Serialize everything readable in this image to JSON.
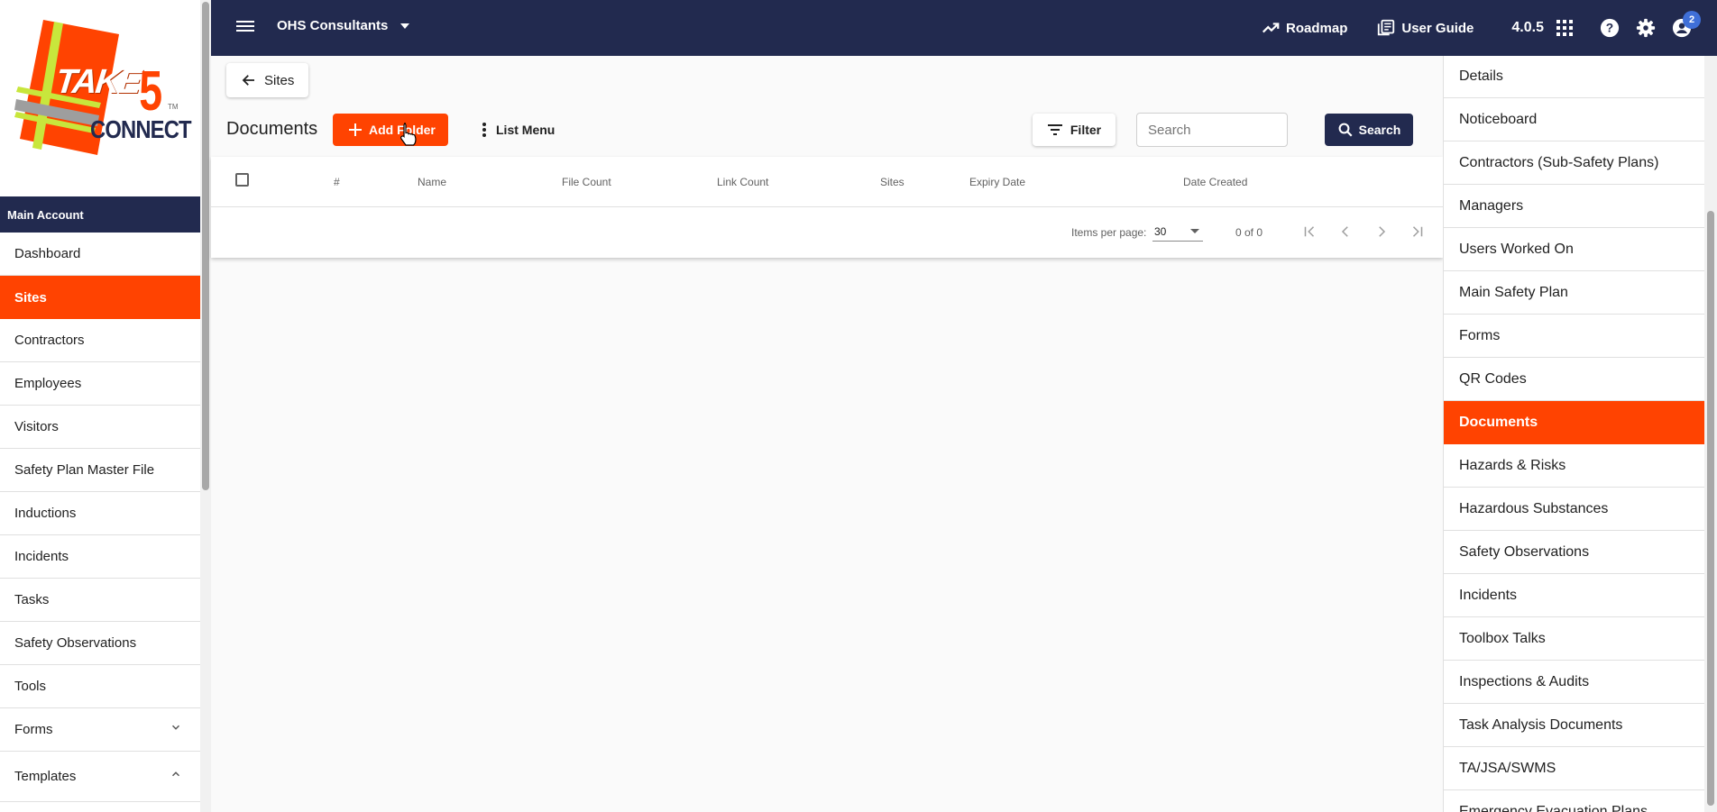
{
  "brand": {
    "logo_top": "TAKE",
    "logo_five": "5",
    "logo_bottom": "CONNECT",
    "logo_tm": "TM"
  },
  "sidebar": {
    "account_header": "Main Account",
    "items": [
      {
        "label": "Dashboard",
        "active": false
      },
      {
        "label": "Sites",
        "active": true
      },
      {
        "label": "Contractors",
        "active": false
      },
      {
        "label": "Employees",
        "active": false
      },
      {
        "label": "Visitors",
        "active": false
      },
      {
        "label": "Safety Plan Master File",
        "active": false
      },
      {
        "label": "Inductions",
        "active": false
      },
      {
        "label": "Incidents",
        "active": false
      },
      {
        "label": "Tasks",
        "active": false
      },
      {
        "label": "Safety Observations",
        "active": false
      },
      {
        "label": "Tools",
        "active": false
      },
      {
        "label": "Forms",
        "active": false
      },
      {
        "label": "Templates",
        "active": false
      }
    ]
  },
  "topbar": {
    "org_name": "OHS Consultants",
    "roadmap": "Roadmap",
    "user_guide": "User Guide",
    "version": "4.0.5",
    "notification_count": "2"
  },
  "main": {
    "back_label": "Sites",
    "title": "Documents",
    "add_folder": "Add Folder",
    "list_menu": "List Menu",
    "filter": "Filter",
    "search_placeholder": "Search",
    "search_button": "Search",
    "columns": [
      "#",
      "Name",
      "File Count",
      "Link Count",
      "Sites",
      "Expiry Date",
      "Date Created"
    ],
    "paginator": {
      "items_per_page_label": "Items per page:",
      "page_size": "30",
      "range": "0 of 0"
    }
  },
  "right_panel": {
    "items": [
      {
        "label": "Details",
        "active": false
      },
      {
        "label": "Noticeboard",
        "active": false
      },
      {
        "label": "Contractors (Sub-Safety Plans)",
        "active": false
      },
      {
        "label": "Managers",
        "active": false
      },
      {
        "label": "Users Worked On",
        "active": false
      },
      {
        "label": "Main Safety Plan",
        "active": false
      },
      {
        "label": "Forms",
        "active": false
      },
      {
        "label": "QR Codes",
        "active": false
      },
      {
        "label": "Documents",
        "active": true
      },
      {
        "label": "Hazards & Risks",
        "active": false
      },
      {
        "label": "Hazardous Substances",
        "active": false
      },
      {
        "label": "Safety Observations",
        "active": false
      },
      {
        "label": "Incidents",
        "active": false
      },
      {
        "label": "Toolbox Talks",
        "active": false
      },
      {
        "label": "Inspections & Audits",
        "active": false
      },
      {
        "label": "Task Analysis Documents",
        "active": false
      },
      {
        "label": "TA/JSA/SWMS",
        "active": false
      },
      {
        "label": "Emergency Evacuation Plans",
        "active": false
      }
    ]
  },
  "colors": {
    "navy": "#222a4f",
    "accent": "#ff4301"
  }
}
